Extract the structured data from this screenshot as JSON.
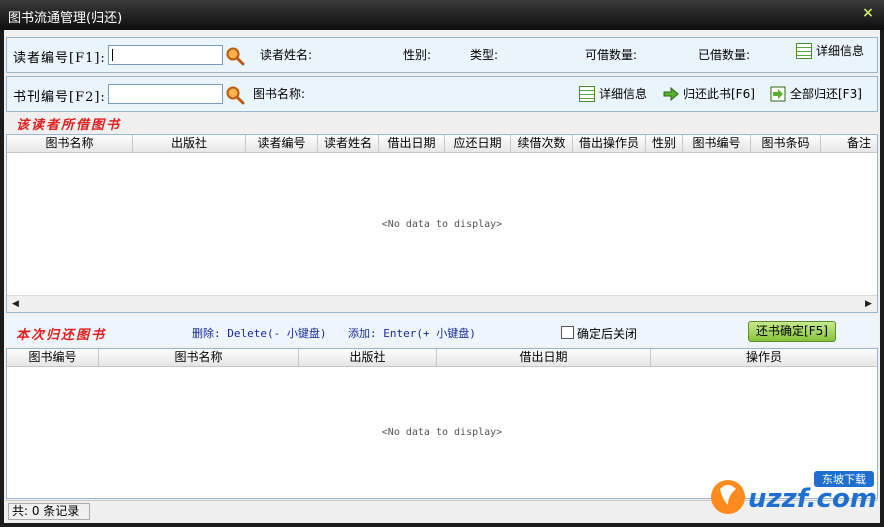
{
  "window": {
    "title": "图书流通管理(归还)",
    "close_glyph": "×"
  },
  "reader_panel": {
    "label": "读者编号[F1]:",
    "input_value": "",
    "name_label": "读者姓名:",
    "gender_label": "性别:",
    "type_label": "类型:",
    "borrowable_label": "可借数量:",
    "borrowed_label": "已借数量:",
    "detail_button": "详细信息"
  },
  "book_panel": {
    "label": "书刊编号[F2]:",
    "input_value": "",
    "book_name_label": "图书名称:",
    "detail_button": "详细信息",
    "return_this_button": "归还此书[F6]",
    "return_all_button": "全部归还[F3]"
  },
  "borrowed_section": {
    "title": "该读者所借图书",
    "columns": [
      "图书名称",
      "出版社",
      "读者编号",
      "读者姓名",
      "借出日期",
      "应还日期",
      "续借次数",
      "借出操作员",
      "性别",
      "图书编号",
      "图书条码",
      "备注"
    ],
    "empty_text": "<No data to display>"
  },
  "return_section": {
    "title": "本次归还图书",
    "delete_hint": "删除: Delete(- 小键盘)",
    "add_hint": "添加: Enter(+ 小键盘)",
    "close_after_label": "确定后关闭",
    "close_after_checked": false,
    "confirm_button": "还书确定[F5]",
    "columns": [
      "图书编号",
      "图书名称",
      "出版社",
      "借出日期",
      "操作员"
    ],
    "empty_text": "<No data to display>"
  },
  "status_bar": {
    "record_count_text": "共: 0 条记录"
  },
  "watermark": {
    "brand": "uzzf.com",
    "cn": "东坡下载"
  }
}
